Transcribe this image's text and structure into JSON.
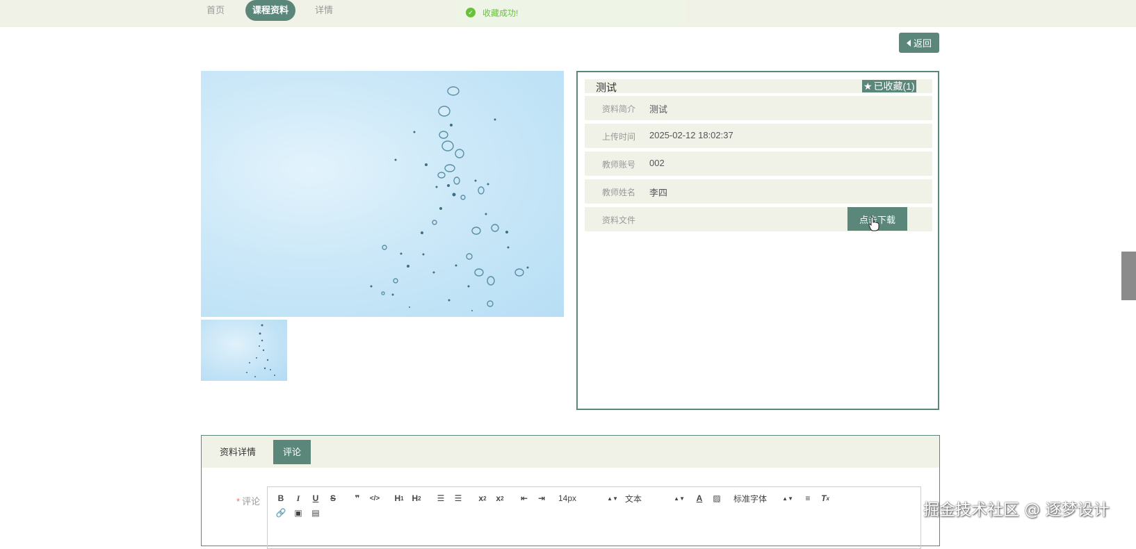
{
  "nav": {
    "items": [
      {
        "label": "首页"
      },
      {
        "label": "课程资料"
      },
      {
        "label": "详情"
      }
    ]
  },
  "toast": {
    "message": "收藏成功!"
  },
  "back_button": {
    "label": "返回"
  },
  "gallery": {
    "main_image": "water-bubbles",
    "thumbnail": "water-bubbles"
  },
  "detail": {
    "title": "测试",
    "favorite_label": "已收藏(1)",
    "rows": [
      {
        "label": "资料简介",
        "value": "测试"
      },
      {
        "label": "上传时间",
        "value": "2025-02-12 18:02:37"
      },
      {
        "label": "教师账号",
        "value": "002"
      },
      {
        "label": "教师姓名",
        "value": "李四"
      },
      {
        "label": "资料文件",
        "value": ""
      }
    ],
    "download_label": "点击下载"
  },
  "tabs": {
    "items": [
      {
        "label": "资料详情"
      },
      {
        "label": "评论"
      }
    ]
  },
  "comment": {
    "required_mark": "*",
    "label": "评论",
    "toolbar": {
      "font_size": "14px",
      "text_type": "文本",
      "font_family": "标准字体"
    }
  },
  "watermark": "掘金技术社区 @ 逐梦设计",
  "colors": {
    "accent": "#5b877a",
    "panel_bg": "#f0f1e7",
    "success": "#67c23a"
  }
}
